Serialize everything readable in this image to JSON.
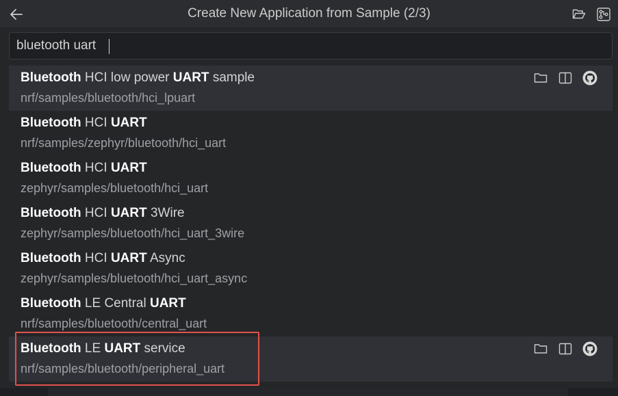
{
  "header": {
    "title": "Create New Application from Sample (2/3)"
  },
  "search": {
    "value": "bluetooth uart",
    "placeholder": ""
  },
  "items": [
    {
      "label_parts": [
        [
          "b",
          "Bluetooth"
        ],
        [
          "n",
          " HCI low power "
        ],
        [
          "b",
          "UART"
        ],
        [
          "n",
          " sample"
        ]
      ],
      "path": "nrf/samples/bluetooth/hci_lpuart",
      "active": true,
      "show_actions": true
    },
    {
      "label_parts": [
        [
          "b",
          "Bluetooth"
        ],
        [
          "n",
          " HCI "
        ],
        [
          "b",
          "UART"
        ]
      ],
      "path": "nrf/samples/zephyr/bluetooth/hci_uart",
      "active": false,
      "show_actions": false
    },
    {
      "label_parts": [
        [
          "b",
          "Bluetooth"
        ],
        [
          "n",
          " HCI "
        ],
        [
          "b",
          "UART"
        ]
      ],
      "path": "zephyr/samples/bluetooth/hci_uart",
      "active": false,
      "show_actions": false
    },
    {
      "label_parts": [
        [
          "b",
          "Bluetooth"
        ],
        [
          "n",
          " HCI "
        ],
        [
          "b",
          "UART"
        ],
        [
          "n",
          " 3Wire"
        ]
      ],
      "path": "zephyr/samples/bluetooth/hci_uart_3wire",
      "active": false,
      "show_actions": false
    },
    {
      "label_parts": [
        [
          "b",
          "Bluetooth"
        ],
        [
          "n",
          " HCI "
        ],
        [
          "b",
          "UART"
        ],
        [
          "n",
          " Async"
        ]
      ],
      "path": "zephyr/samples/bluetooth/hci_uart_async",
      "active": false,
      "show_actions": false
    },
    {
      "label_parts": [
        [
          "b",
          "Bluetooth"
        ],
        [
          "n",
          " LE Central "
        ],
        [
          "b",
          "UART"
        ]
      ],
      "path": "nrf/samples/bluetooth/central_uart",
      "active": false,
      "show_actions": false
    },
    {
      "label_parts": [
        [
          "b",
          "Bluetooth"
        ],
        [
          "n",
          " LE "
        ],
        [
          "b",
          "UART"
        ],
        [
          "n",
          " service"
        ]
      ],
      "path": "nrf/samples/bluetooth/peripheral_uart",
      "active": true,
      "show_actions": true
    }
  ],
  "icons": {
    "back": "arrow-left-icon",
    "title_action_1": "open-folder-icon",
    "title_action_2": "settings-tree-icon",
    "item_action_1": "folder-icon",
    "item_action_2": "split-view-icon",
    "item_action_3": "github-icon"
  },
  "colors": {
    "accent_highlight": "#e3524d",
    "active_row": "#2f3136"
  }
}
